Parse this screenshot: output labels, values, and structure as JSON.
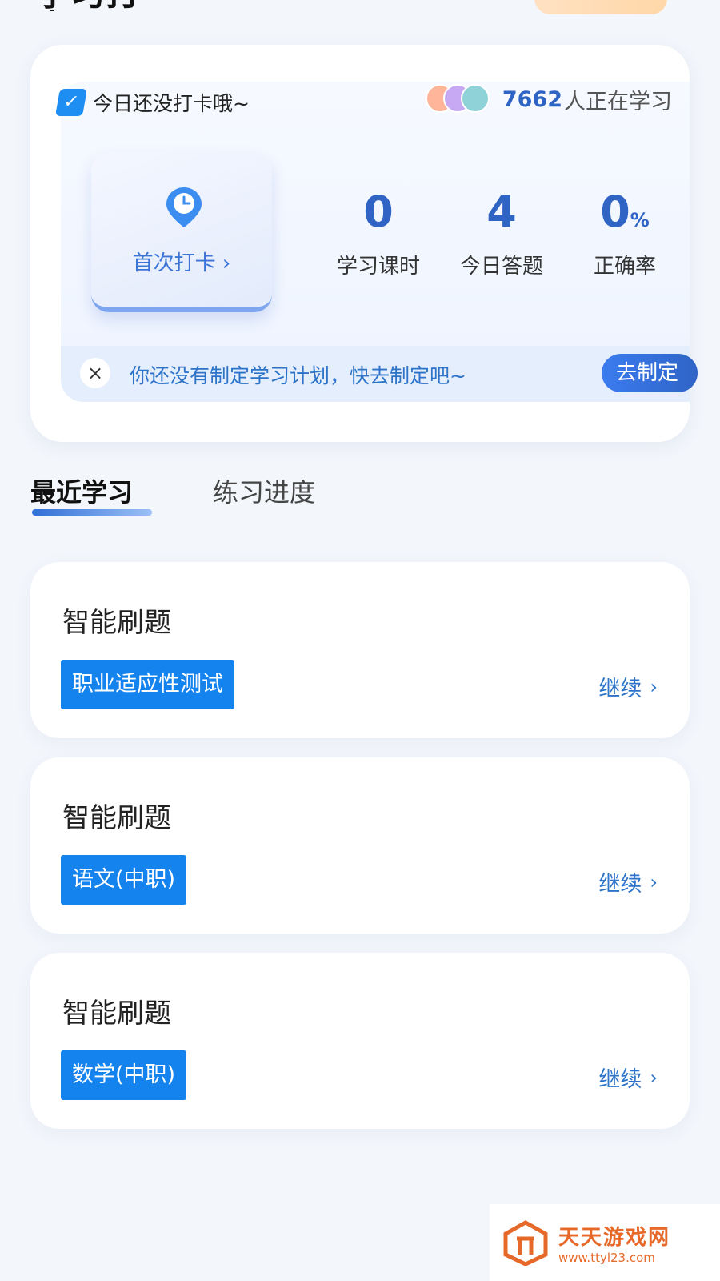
{
  "header": {
    "title": "学习打卡"
  },
  "checkin": {
    "status_text": "今日还没打卡哦~",
    "learner_count": "7662",
    "learner_label": "人正在学习",
    "first_checkin_label": "首次打卡 ›",
    "stats": [
      {
        "value": "0",
        "unit": "",
        "label": "学习课时"
      },
      {
        "value": "4",
        "unit": "",
        "label": "今日答题"
      },
      {
        "value": "0",
        "unit": "%",
        "label": "正确率"
      }
    ],
    "plan_text": "你还没有制定学习计划，快去制定吧~",
    "plan_button": "去制定",
    "close_symbol": "×"
  },
  "tabs": [
    {
      "label": "最近学习",
      "active": true
    },
    {
      "label": "练习进度",
      "active": false
    }
  ],
  "practice_cards": [
    {
      "title": "智能刷题",
      "tag": "职业适应性测试",
      "action": "继续"
    },
    {
      "title": "智能刷题",
      "tag": "语文(中职)",
      "action": "继续"
    },
    {
      "title": "智能刷题",
      "tag": "数学(中职)",
      "action": "继续"
    }
  ],
  "watermark": {
    "name": "天天游戏网",
    "url": "www.ttyl23.com"
  },
  "colors": {
    "accent": "#2f64c5",
    "tag_blue": "#1583ee",
    "watermark_orange": "#e7692a"
  },
  "icons": {
    "memo": "memo-check-icon",
    "clock": "clock-pin-icon",
    "chevron": "chevron-right-icon",
    "close": "close-icon"
  }
}
